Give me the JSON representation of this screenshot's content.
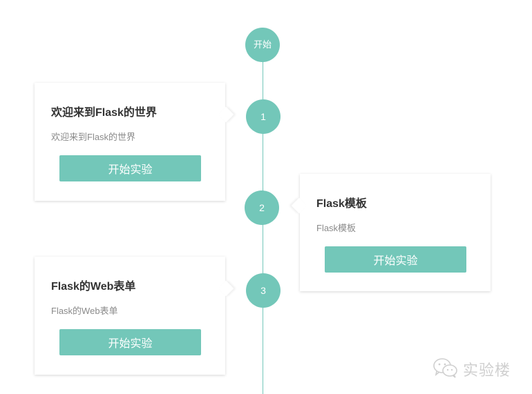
{
  "timeline": {
    "start_label": "开始",
    "steps": [
      {
        "number": "1",
        "title": "欢迎来到Flask的世界",
        "description": "欢迎来到Flask的世界",
        "button_label": "开始实验"
      },
      {
        "number": "2",
        "title": "Flask模板",
        "description": "Flask模板",
        "button_label": "开始实验"
      },
      {
        "number": "3",
        "title": "Flask的Web表单",
        "description": "Flask的Web表单",
        "button_label": "开始实验"
      }
    ]
  },
  "watermark": {
    "text": "实验楼",
    "icon": "wechat-icon"
  },
  "colors": {
    "accent": "#73c7b9",
    "title": "#333333",
    "muted": "#8a8a8a"
  }
}
